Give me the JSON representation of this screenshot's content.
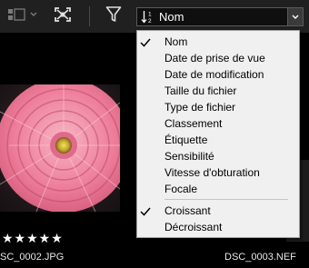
{
  "toolbar": {
    "sort_value": "Nom"
  },
  "menu": {
    "sort_items": [
      {
        "label": "Nom",
        "checked": true
      },
      {
        "label": "Date de prise de vue",
        "checked": false
      },
      {
        "label": "Date de modification",
        "checked": false
      },
      {
        "label": "Taille du fichier",
        "checked": false
      },
      {
        "label": "Type de fichier",
        "checked": false
      },
      {
        "label": "Classement",
        "checked": false
      },
      {
        "label": "Étiquette",
        "checked": false
      },
      {
        "label": "Sensibilité",
        "checked": false
      },
      {
        "label": "Vitesse d'obturation",
        "checked": false
      },
      {
        "label": "Focale",
        "checked": false
      }
    ],
    "order_items": [
      {
        "label": "Croissant",
        "checked": true
      },
      {
        "label": "Décroissant",
        "checked": false
      }
    ]
  },
  "thumbnails": [
    {
      "filename": "SC_0002.JPG",
      "rating": "★★★★★"
    },
    {
      "filename": "DSC_0003.NEF"
    }
  ],
  "colors": {
    "toolbar_bg": "#202020",
    "menu_bg": "#f0f0f0",
    "content_bg": "#000000"
  }
}
